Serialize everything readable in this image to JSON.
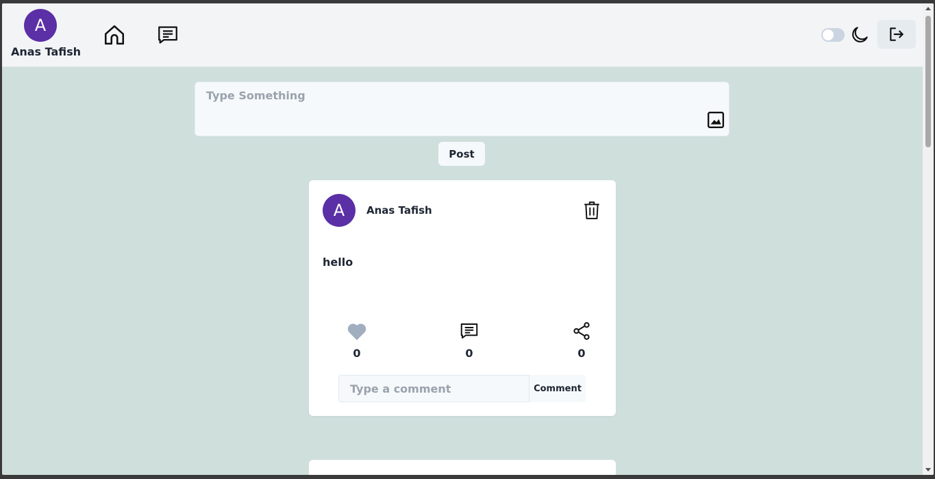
{
  "header": {
    "avatar_letter": "A",
    "username": "Anas Tafish",
    "icons": [
      "home-icon",
      "chat-icon",
      "moon-icon",
      "logout-icon"
    ],
    "theme_toggle_on": false
  },
  "composer": {
    "placeholder": "Type Something",
    "post_label": "Post"
  },
  "post": {
    "avatar_letter": "A",
    "author": "Anas Tafish",
    "text": "hello",
    "likes": "0",
    "comments": "0",
    "shares": "0",
    "comment_placeholder": "Type a comment",
    "comment_button": "Comment"
  },
  "colors": {
    "avatar": "#5b2fa6",
    "page_background": "#cfdfdc",
    "header_background": "#f2f4f6"
  }
}
